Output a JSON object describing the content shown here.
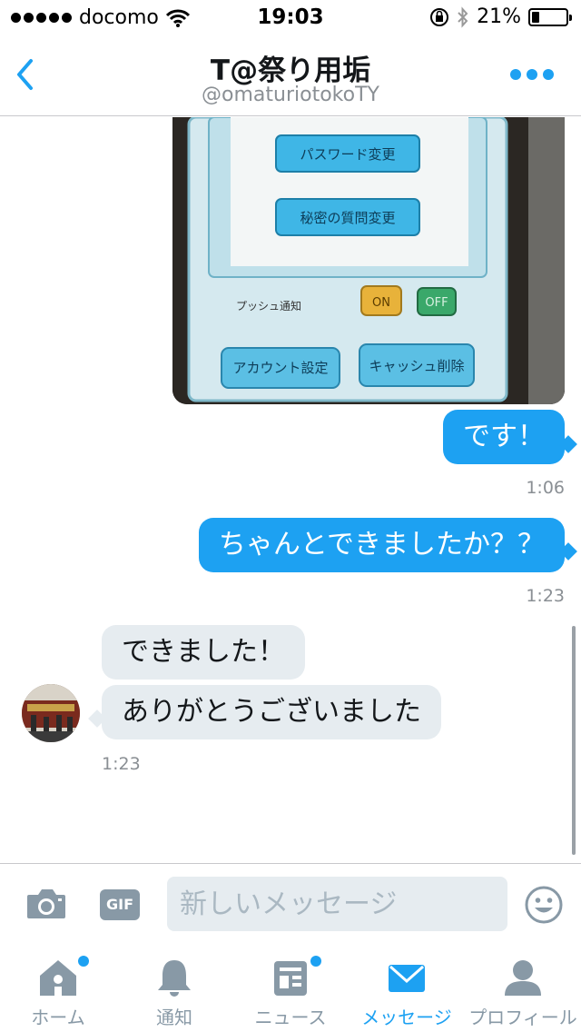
{
  "status_bar": {
    "carrier": "docomo",
    "time": "19:03",
    "battery_percent": "21%",
    "battery_level": 0.21
  },
  "header": {
    "title": "T@祭り用垢",
    "handle": "@omaturiotokoTY"
  },
  "photo": {
    "buttons": [
      "パスワード変更",
      "秘密の質問変更"
    ],
    "push_label": "プッシュ通知",
    "on": "ON",
    "off": "OFF",
    "bottom_buttons": [
      "アカウント設定",
      "キャッシュ削除"
    ]
  },
  "messages": [
    {
      "side": "sent",
      "text": "です！",
      "time": "1:06"
    },
    {
      "side": "sent",
      "text": "ちゃんとできましたか？？",
      "time": "1:23"
    },
    {
      "side": "received",
      "text": "できました！"
    },
    {
      "side": "received",
      "text": "ありがとうございました",
      "time": "1:23"
    }
  ],
  "composer": {
    "placeholder": "新しいメッセージ",
    "gif_label": "GIF",
    "icons": [
      "camera-icon",
      "smiley-icon"
    ]
  },
  "tabs": [
    {
      "label": "ホーム",
      "icon": "home-icon",
      "badge": true
    },
    {
      "label": "通知",
      "icon": "bell-icon",
      "badge": false
    },
    {
      "label": "ニュース",
      "icon": "news-icon",
      "badge": true
    },
    {
      "label": "メッセージ",
      "icon": "envelope-icon",
      "badge": false,
      "active": true
    },
    {
      "label": "プロフィール",
      "icon": "person-icon",
      "badge": false
    }
  ],
  "colors": {
    "accent": "#1da1f2",
    "received_bubble": "#e6ecf0",
    "muted": "#8899a6"
  }
}
